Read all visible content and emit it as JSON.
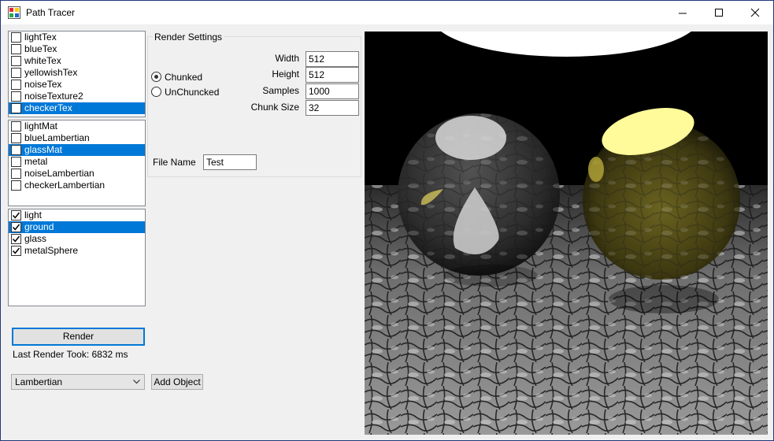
{
  "window": {
    "title": "Path Tracer",
    "controls": [
      "minimize-icon",
      "maximize-icon",
      "close-icon"
    ]
  },
  "textures": {
    "items": [
      {
        "label": "lightTex",
        "checked": false,
        "selected": false
      },
      {
        "label": "blueTex",
        "checked": false,
        "selected": false
      },
      {
        "label": "whiteTex",
        "checked": false,
        "selected": false
      },
      {
        "label": "yellowishTex",
        "checked": false,
        "selected": false
      },
      {
        "label": "noiseTex",
        "checked": false,
        "selected": false
      },
      {
        "label": "noiseTexture2",
        "checked": false,
        "selected": false
      },
      {
        "label": "checkerTex",
        "checked": false,
        "selected": true
      }
    ]
  },
  "materials": {
    "items": [
      {
        "label": "lightMat",
        "checked": false,
        "selected": false
      },
      {
        "label": "blueLambertian",
        "checked": false,
        "selected": false
      },
      {
        "label": "glassMat",
        "checked": false,
        "selected": true
      },
      {
        "label": "metal",
        "checked": false,
        "selected": false
      },
      {
        "label": "noiseLambertian",
        "checked": false,
        "selected": false
      },
      {
        "label": "checkerLambertian",
        "checked": false,
        "selected": false
      }
    ]
  },
  "objects": {
    "items": [
      {
        "label": "light",
        "checked": true,
        "selected": false
      },
      {
        "label": "ground",
        "checked": true,
        "selected": true
      },
      {
        "label": "glass",
        "checked": true,
        "selected": false
      },
      {
        "label": "metalSphere",
        "checked": true,
        "selected": false
      }
    ]
  },
  "render_settings": {
    "title": "Render Settings",
    "mode": {
      "chunked_label": "Chunked",
      "unchunked_label": "UnChuncked",
      "selected": "chunked"
    },
    "width_label": "Width",
    "width_value": "512",
    "height_label": "Height",
    "height_value": "512",
    "samples_label": "Samples",
    "samples_value": "1000",
    "chunk_size_label": "Chunk Size",
    "chunk_size_value": "32",
    "file_name_label": "File Name",
    "file_name_value": "Test"
  },
  "actions": {
    "render_label": "Render",
    "last_render_text": "Last Render Took: 6832 ms",
    "object_type_value": "Lambertian",
    "add_object_label": "Add Object"
  },
  "colors": {
    "selection": "#0078d7",
    "window_bg": "#f0f0f0",
    "title_border": "#1f3a7a"
  }
}
